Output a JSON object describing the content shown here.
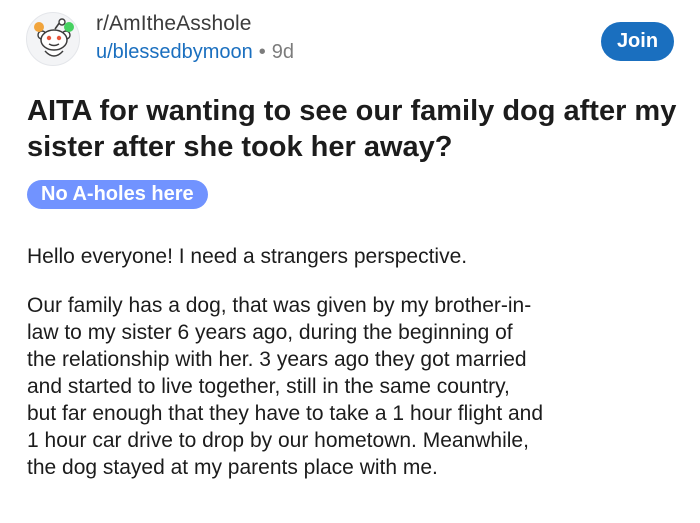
{
  "header": {
    "subreddit": "r/AmItheAsshole",
    "username": "u/blessedbymoon",
    "separator": "•",
    "age": "9d",
    "join_label": "Join"
  },
  "post": {
    "title": "AITA for wanting to see our family dog after my sister after she took her away?",
    "flair": "No A-holes here",
    "paragraphs": [
      "Hello everyone! I need a strangers perspective.",
      "Our family has a dog, that was given by my brother-in-\nlaw to my sister 6 years ago, during the beginning of\nthe relationship with her. 3 years ago they got married\nand started to live together, still in the same country,\nbut far enough that they have to take a 1 hour flight and\n1 hour car drive to drop by our hometown. Meanwhile,\nthe dog stayed at my parents place with me."
    ]
  },
  "colors": {
    "accent": "#1a6fbf",
    "flair": "#7193ff",
    "text": "#1c1c1c",
    "muted": "#7c7c7c"
  },
  "icons": {
    "avatar": "subreddit-avatar-icon"
  }
}
